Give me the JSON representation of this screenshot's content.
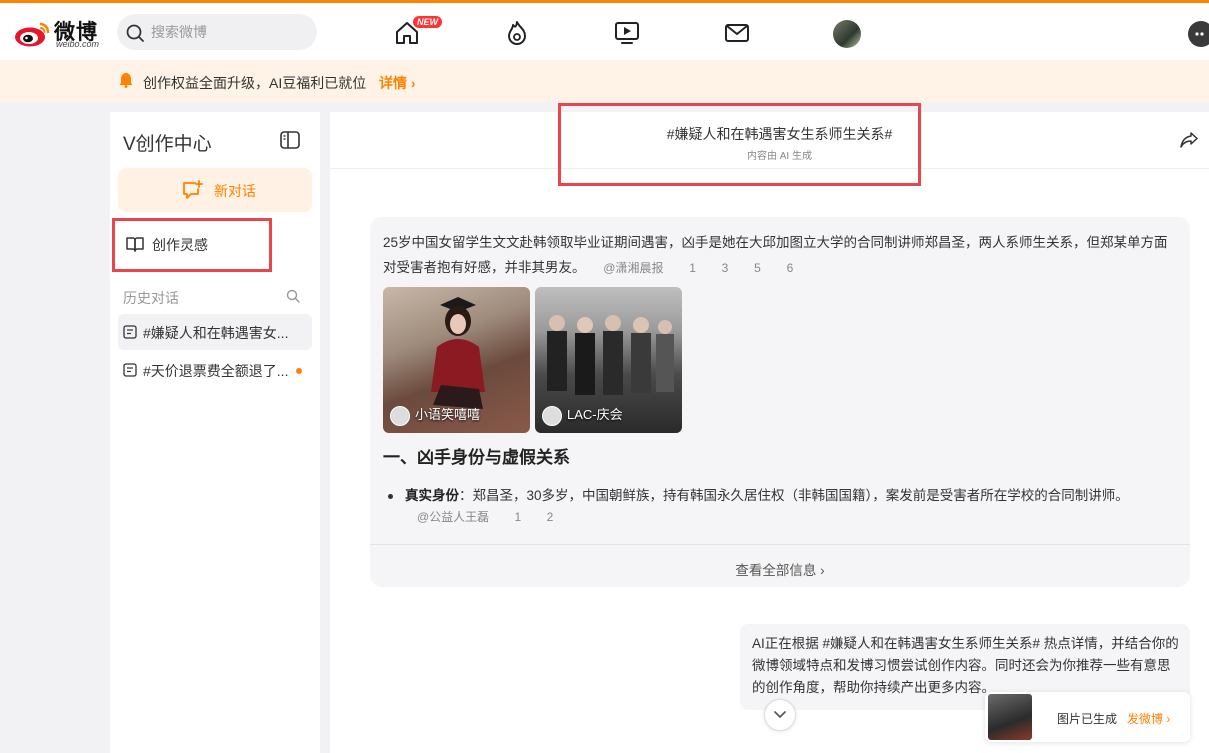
{
  "header": {
    "brand": "微博",
    "brand_sub": "weibo.com",
    "search_placeholder": "搜索微博",
    "new_badge": "NEW",
    "icons": [
      "home-icon",
      "hot-icon",
      "video-icon",
      "mail-icon",
      "avatar",
      "more-icon"
    ]
  },
  "notice": {
    "text": "创作权益全面升级，AI豆福利已就位",
    "link": "详情 ›"
  },
  "sidebar": {
    "title": "V创作中心",
    "new_chat": "新对话",
    "inspiration": "创作灵感",
    "history_label": "历史对话",
    "history": [
      {
        "title": "#嫌疑人和在韩遇害女..."
      },
      {
        "title": "#天价退票费全额退了...",
        "unread": true
      }
    ]
  },
  "main": {
    "title": "#嫌疑人和在韩遇害女生系师生关系#",
    "subtitle": "内容由 AI 生成",
    "card": {
      "paragraph": "25岁中国女留学生文文赴韩领取毕业证期间遇害，凶手是她在大邱加图立大学的合同制讲师郑昌圣，两人系师生关系，但郑某单方面对受害者抱有好感，并非其男友。",
      "paragraph_ref": "@潇湘晨报",
      "paragraph_nums": [
        "1",
        "3",
        "5",
        "6"
      ],
      "images": [
        {
          "caption": "小语笑嘻嘻"
        },
        {
          "caption": "LAC-庆会"
        }
      ],
      "section_title": "一、凶手身份与虚假关系",
      "bullet_label": "真实身份",
      "bullet_text": "：郑昌圣，30多岁，中国朝鲜族，持有韩国永久居住权（非韩国国籍），案发前是受害者所在学校的合同制讲师。",
      "bullet_ref": "@公益人王磊",
      "bullet_nums": [
        "1",
        "2"
      ],
      "view_all": "查看全部信息 ›"
    },
    "ai_message": "AI正在根据 #嫌疑人和在韩遇害女生系师生关系# 热点详情，并结合你的微博领域特点和发博习惯尝试创作内容。同时还会为你推荐一些有意思的创作角度，帮助你持续产出更多内容。",
    "toast": {
      "message": "图片已生成",
      "action": "发微博 ›"
    }
  },
  "colors": {
    "accent": "#ff8200",
    "highlight_border": "#e8464c"
  }
}
